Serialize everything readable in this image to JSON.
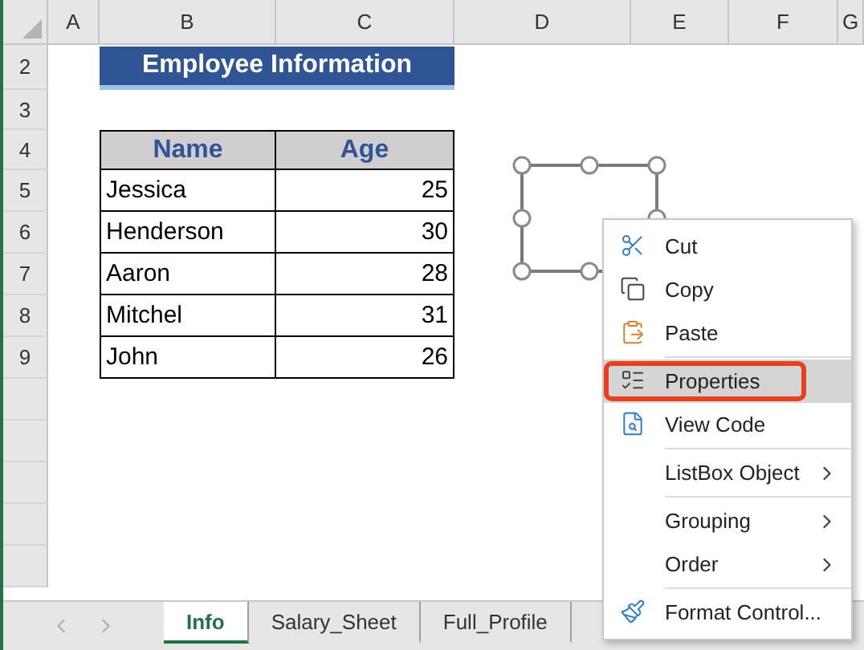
{
  "column_headers": [
    "A",
    "B",
    "C",
    "D",
    "E",
    "F",
    "G"
  ],
  "row_headers": [
    "2",
    "3",
    "4",
    "5",
    "6",
    "7",
    "8",
    "9"
  ],
  "title": "Employee Information",
  "table": {
    "columns": [
      "Name",
      "Age"
    ],
    "rows": [
      [
        "Jessica",
        "25"
      ],
      [
        "Henderson",
        "30"
      ],
      [
        "Aaron",
        "28"
      ],
      [
        "Mitchel",
        "31"
      ],
      [
        "John",
        "26"
      ]
    ]
  },
  "context_menu": {
    "items": [
      {
        "kind": "cut",
        "label": "Cut",
        "selected": false
      },
      {
        "kind": "copy",
        "label": "Copy",
        "selected": false
      },
      {
        "kind": "paste",
        "label": "Paste",
        "selected": false
      },
      {
        "kind": "separator"
      },
      {
        "kind": "properties",
        "label": "Properties",
        "selected": true
      },
      {
        "kind": "view_code",
        "label": "View Code",
        "selected": false
      },
      {
        "kind": "separator"
      },
      {
        "kind": "submenu",
        "label": "ListBox Object",
        "selected": false
      },
      {
        "kind": "separator"
      },
      {
        "kind": "submenu",
        "label": "Grouping",
        "selected": false
      },
      {
        "kind": "submenu",
        "label": "Order",
        "selected": false
      },
      {
        "kind": "separator"
      },
      {
        "kind": "format",
        "label": "Format Control...",
        "selected": false
      }
    ]
  },
  "sheet_tabs": [
    {
      "label": "Info",
      "selected": true
    },
    {
      "label": "Salary_Sheet",
      "selected": false
    },
    {
      "label": "Full_Profile",
      "selected": false
    }
  ]
}
